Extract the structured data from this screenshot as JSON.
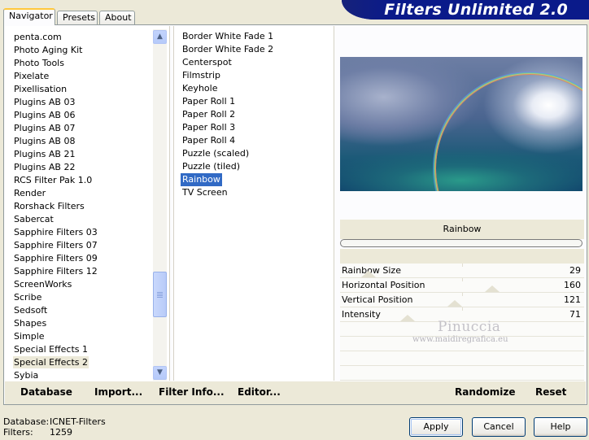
{
  "tabs": [
    "Navigator",
    "Presets",
    "About"
  ],
  "app_title": "Filters Unlimited 2.0",
  "categories": [
    "penta.com",
    "Photo Aging Kit",
    "Photo Tools",
    "Pixelate",
    "Pixellisation",
    "Plugins AB 03",
    "Plugins AB 06",
    "Plugins AB 07",
    "Plugins AB 08",
    "Plugins AB 21",
    "Plugins AB 22",
    "RCS Filter Pak 1.0",
    "Render",
    "Rorshack Filters",
    "Sabercat",
    "Sapphire Filters 03",
    "Sapphire Filters 07",
    "Sapphire Filters 09",
    "Sapphire Filters 12",
    "ScreenWorks",
    "Scribe",
    "Sedsoft",
    "Shapes",
    "Simple",
    "Special Effects 1",
    "Special Effects 2",
    "Sybia"
  ],
  "selected_category": "Special Effects 2",
  "filters": [
    "Border White Fade 1",
    "Border White Fade 2",
    "Centerspot",
    "Filmstrip",
    "Keyhole",
    "Paper Roll 1",
    "Paper Roll 2",
    "Paper Roll 3",
    "Paper Roll 4",
    "Puzzle (scaled)",
    "Puzzle (tiled)",
    "Rainbow",
    "TV Screen"
  ],
  "selected_filter": "Rainbow",
  "filter_name": "Rainbow",
  "parameters": [
    {
      "label": "Rainbow Size",
      "value": "29"
    },
    {
      "label": "Horizontal Position",
      "value": "160"
    },
    {
      "label": "Vertical Position",
      "value": "121"
    },
    {
      "label": "Intensity",
      "value": "71"
    }
  ],
  "watermark": {
    "line1": "Pinuccia",
    "line2": "www.maidiregrafica.eu"
  },
  "bottom_links": {
    "database": "Database",
    "import": "Import...",
    "filter_info": "Filter Info...",
    "editor": "Editor...",
    "randomize": "Randomize",
    "reset": "Reset"
  },
  "status": {
    "database_label": "Database:",
    "database_value": "ICNET-Filters",
    "filters_label": "Filters:",
    "filters_value": "1259"
  },
  "buttons": {
    "apply": "Apply",
    "cancel": "Cancel",
    "help": "Help"
  },
  "colors": {
    "selection": "#316ac5",
    "banner": "#0a1a8a",
    "window": "#ece9d8"
  }
}
